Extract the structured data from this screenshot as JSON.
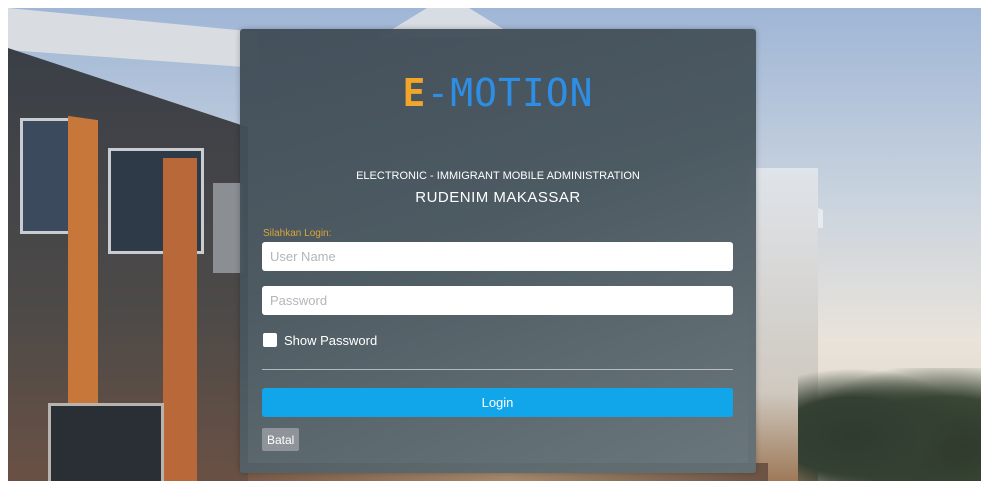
{
  "logo": {
    "prefix": "E",
    "rest": "-MOTION",
    "prefix_color": "#f1a529",
    "rest_color": "#2d8ee6"
  },
  "subtitle": "ELECTRONIC - IMMIGRANT MOBILE ADMINISTRATION",
  "site_name": "RUDENIM MAKASSAR",
  "login_prompt": "Silahkan Login:",
  "username": {
    "value": "",
    "placeholder": "User Name"
  },
  "password": {
    "value": "",
    "placeholder": "Password"
  },
  "show_password": {
    "label": "Show Password",
    "checked": false
  },
  "buttons": {
    "login": "Login",
    "cancel": "Batal"
  },
  "colors": {
    "login_button": "#11a5ea",
    "cancel_button": "#8e9499",
    "prompt_text": "#d9a53a"
  }
}
